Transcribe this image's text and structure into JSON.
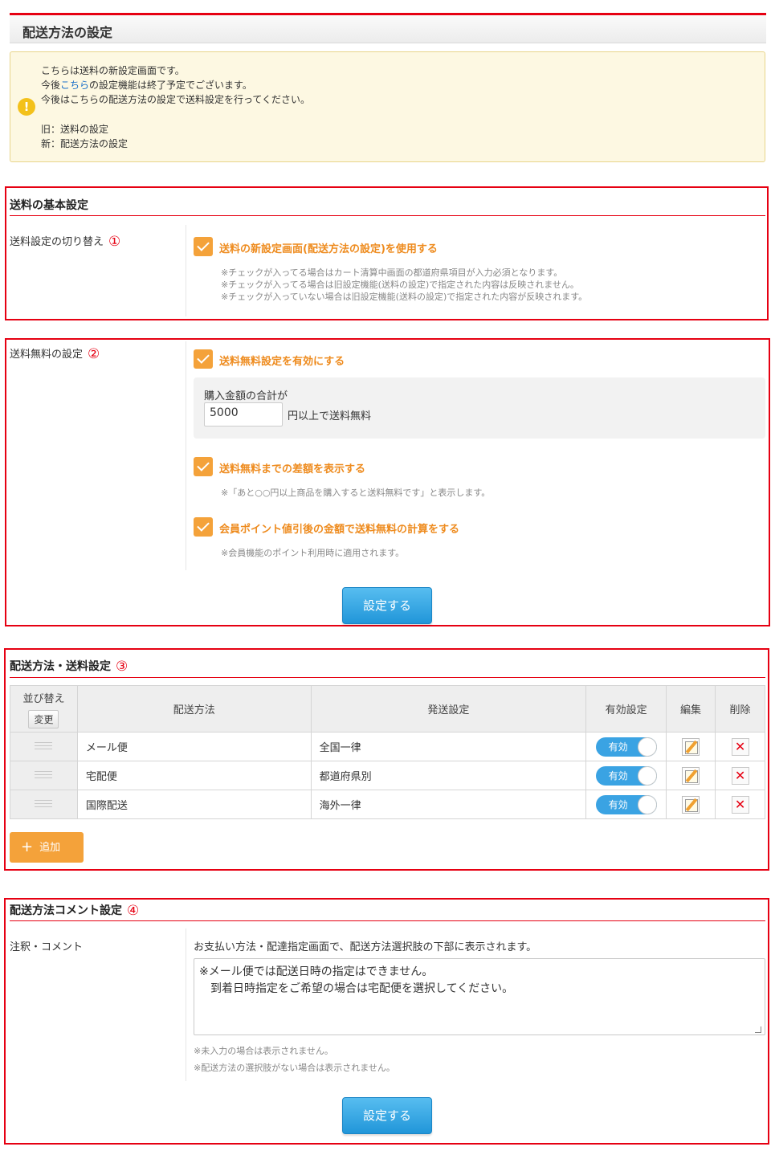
{
  "page_title": "配送方法の設定",
  "notice": {
    "line1": "こちらは送料の新設定画面です。",
    "line2_prefix": "今後",
    "line2_link": "こちら",
    "line2_suffix": "の設定機能は終了予定でございます。",
    "line3": "今後はこちらの配送方法の設定で送料設定を行ってください。",
    "old": "旧：送料の設定",
    "new": "新：配送方法の設定"
  },
  "basic": {
    "title": "送料の基本設定",
    "row_label": "送料設定の切り替え",
    "marker": "①",
    "checkbox_label": "送料の新設定画面(配送方法の設定)を使用する",
    "notes": [
      "※チェックが入ってる場合はカート清算中画面の都道府県項目が入力必須となります。",
      "※チェックが入ってる場合は旧設定機能(送料の設定)で指定された内容は反映されません。",
      "※チェックが入っていない場合は旧設定機能(送料の設定)で指定された内容が反映されます。"
    ]
  },
  "free": {
    "row_label": "送料無料の設定",
    "marker": "②",
    "enable_label": "送料無料設定を有効にする",
    "amount_caption": "購入金額の合計が",
    "amount_value": "5000",
    "amount_suffix": "円以上で送料無料",
    "diff_label": "送料無料までの差額を表示する",
    "diff_note": "※「あと○○円以上商品を購入すると送料無料です」と表示します。",
    "point_label": "会員ポイント値引後の金額で送料無料の計算をする",
    "point_note": "※会員機能のポイント利用時に適用されます。",
    "submit": "設定する"
  },
  "methods": {
    "title": "配送方法・送料設定",
    "marker": "③",
    "headers": {
      "sort": "並び替え",
      "sort_button": "変更",
      "method": "配送方法",
      "shipping": "発送設定",
      "enabled": "有効設定",
      "edit": "編集",
      "delete": "削除"
    },
    "rows": [
      {
        "method": "メール便",
        "shipping": "全国一律",
        "toggle": "有効"
      },
      {
        "method": "宅配便",
        "shipping": "都道府県別",
        "toggle": "有効"
      },
      {
        "method": "国際配送",
        "shipping": "海外一律",
        "toggle": "有効"
      }
    ],
    "add_button": "追加"
  },
  "comment": {
    "title": "配送方法コメント設定",
    "marker": "④",
    "row_label": "注釈・コメント",
    "description": "お支払い方法・配達指定画面で、配送方法選択肢の下部に表示されます。",
    "text": "※メール便では配送日時の指定はできません。\n　到着日時指定をご希望の場合は宅配便を選択してください。",
    "notes": [
      "※未入力の場合は表示されません。",
      "※配送方法の選択肢がない場合は表示されません。"
    ],
    "submit": "設定する"
  },
  "colors": {
    "accent_red": "#e60012",
    "check_orange": "#f4a23a",
    "button_blue": "#2196d9",
    "notice_bg": "#fdf8e2"
  }
}
